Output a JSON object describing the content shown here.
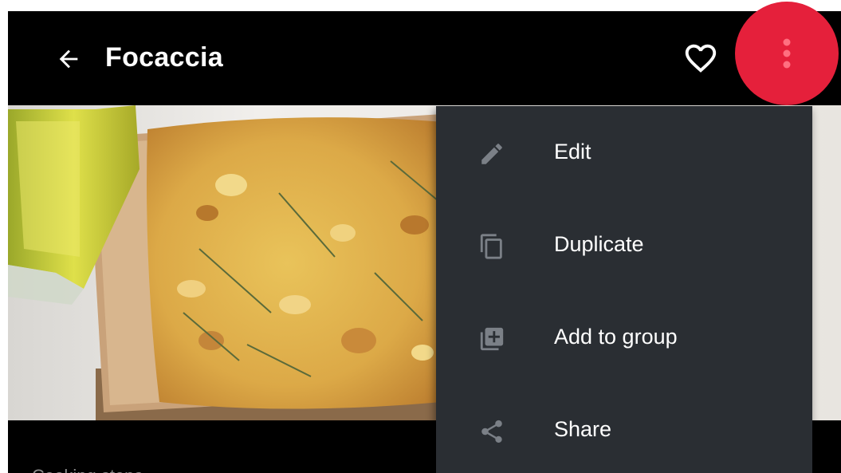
{
  "app_bar": {
    "title": "Focaccia",
    "back_icon": "arrow-back-icon",
    "favorite_icon": "heart-outline-icon",
    "more_icon": "more-vert-icon",
    "accent_color": "#e5203b"
  },
  "hero": {
    "image": "focaccia-photo"
  },
  "content": {
    "section_label": "Cooking steps"
  },
  "menu": {
    "items": [
      {
        "label": "Edit",
        "icon": "pencil-icon"
      },
      {
        "label": "Duplicate",
        "icon": "copy-icon"
      },
      {
        "label": "Add to group",
        "icon": "add-to-group-icon"
      },
      {
        "label": "Share",
        "icon": "share-icon"
      }
    ]
  }
}
